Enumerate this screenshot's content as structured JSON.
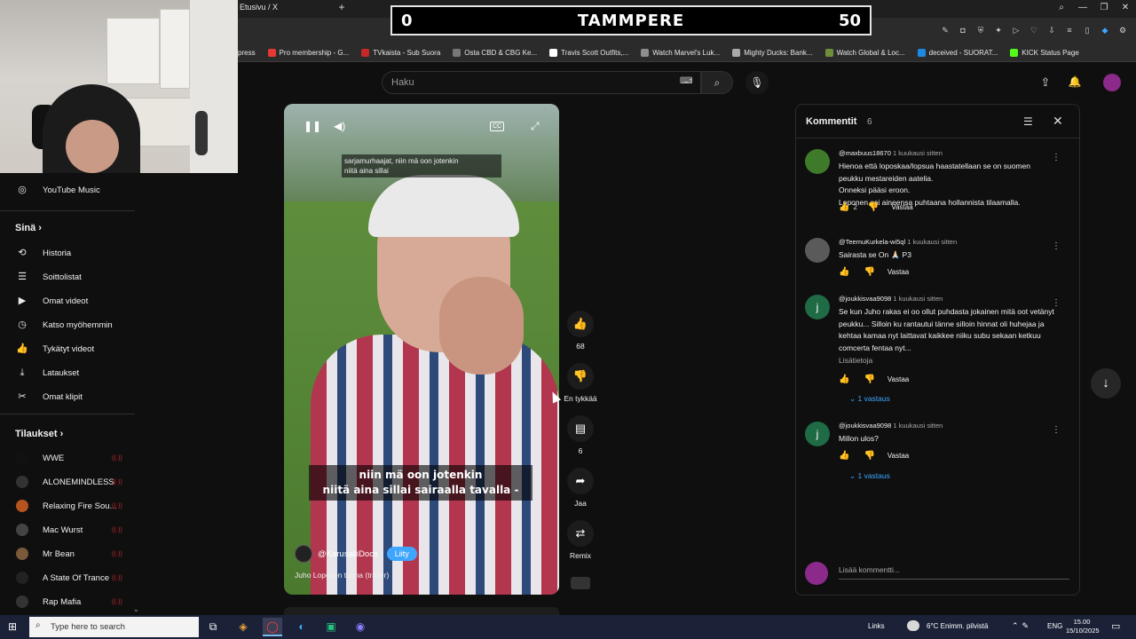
{
  "browser": {
    "tab_title": "Etusivu / X",
    "new_tab_icon": "+",
    "bookmarks": [
      {
        "label": "press",
        "color": "#2b2b2b"
      },
      {
        "label": "Pro membership - G...",
        "color": "#e53935"
      },
      {
        "label": "TVkaista - Sub Suora",
        "color": "#c62828"
      },
      {
        "label": "Osta CBD & CBG Ke...",
        "color": "#777777"
      },
      {
        "label": "Travis Scott Outfits,...",
        "color": "#ffffff"
      },
      {
        "label": "Watch Marvel's Luk...",
        "color": "#8e8e8e"
      },
      {
        "label": "Mighty Ducks: Bank...",
        "color": "#aaaaaa"
      },
      {
        "label": "Watch Global & Loc...",
        "color": "#6d8f3a"
      },
      {
        "label": "deceived - SUORAT...",
        "color": "#1e88e5"
      },
      {
        "label": "KICK Status Page",
        "color": "#53fc18"
      }
    ]
  },
  "scoreboard": {
    "left": "0",
    "title": "TAMMPERE",
    "right": "50"
  },
  "youtube": {
    "search_placeholder": "Haku"
  },
  "sidebar": {
    "top_item": "YouTube Music",
    "sina_heading": "Sinä",
    "sina_items": [
      {
        "label": "Historia",
        "icon": "history-icon"
      },
      {
        "label": "Soittolistat",
        "icon": "playlists-icon"
      },
      {
        "label": "Omat videot",
        "icon": "your-videos-icon"
      },
      {
        "label": "Katso myöhemmin",
        "icon": "watch-later-icon"
      },
      {
        "label": "Tykätyt videot",
        "icon": "liked-videos-icon"
      },
      {
        "label": "Lataukset",
        "icon": "downloads-icon"
      },
      {
        "label": "Omat klipit",
        "icon": "clips-icon"
      }
    ],
    "subs_heading": "Tilaukset",
    "subscriptions": [
      {
        "label": "WWE",
        "color": "#111111"
      },
      {
        "label": "ALONEMINDLESS",
        "color": "#333333"
      },
      {
        "label": "Relaxing Fire Sou...",
        "color": "#b5541e"
      },
      {
        "label": "Mac Wurst",
        "color": "#444444"
      },
      {
        "label": "Mr Bean",
        "color": "#7a5a3a"
      },
      {
        "label": "A State Of Trance",
        "color": "#222222"
      },
      {
        "label": "Rap Mafia",
        "color": "#333333"
      }
    ]
  },
  "video": {
    "subtitle_top": "sarjamurhaajat, niin mä oon jotenkin\nniitä aina sillai",
    "subtitle_main": "niin mä oon jotenkin\nniitä aina sillai sairaalla tavalla -",
    "channel": "@KarusalliDocs",
    "join": "Liity",
    "title": "Juho Loposen tarina (trailer)"
  },
  "actions": {
    "likes": "68",
    "dislike": "En tykkää",
    "comments": "6",
    "share": "Jaa",
    "remix": "Remix"
  },
  "comments_panel": {
    "title": "Kommentit",
    "count": "6",
    "reply_label": "Vastaa",
    "items": [
      {
        "author": "@maxbuus18670",
        "time": "1 kuukausi sitten",
        "text": "Hienoa että loposkaa/lopsua haastatellaan se on suomen peukku mestareiden aatelia.\nOnneksi pääsi eroon.\nLoponen sai aineensa puhtaana hollannista tilaamalla.",
        "likes": "2",
        "avatar_color": "#3f7a2a",
        "avatar_letter": ""
      },
      {
        "author": "@TeemuKurkela-wi5ql",
        "time": "1 kuukausi sitten",
        "text": "Sairasta se On 🙏🏻 P3",
        "likes": "",
        "avatar_color": "#5a5a5a",
        "avatar_letter": ""
      },
      {
        "author": "@joukkisvaa9098",
        "time": "1 kuukausi sitten",
        "text": "Se kun Juho rakas ei oo ollut puhdasta jokainen mitä oot vetänyt peukku... Silloin ku rantautui tänne silloin hinnat oli huhejaa ja kehtaa kamaa nyt laittavat kaikkee niiku subu sekaan ketkuu comcerta fentaa nyt...",
        "more_label": "Lisätietoja",
        "likes": "",
        "replies": "1 vastaus",
        "avatar_color": "#1e6b45",
        "avatar_letter": "j"
      },
      {
        "author": "@joukkisvaa9098",
        "time": "1 kuukausi sitten",
        "text": "Millon ulos?",
        "likes": "",
        "replies": "1 vastaus",
        "avatar_color": "#1e6b45",
        "avatar_letter": "j"
      }
    ],
    "add_placeholder": "Lisää kommentti..."
  },
  "taskbar": {
    "search_placeholder": "Type here to search",
    "links": "Links",
    "weather": "6°C  Enimm. pilvistä",
    "lang": "ENG",
    "time": "15.00",
    "date": "15/10/2025"
  }
}
